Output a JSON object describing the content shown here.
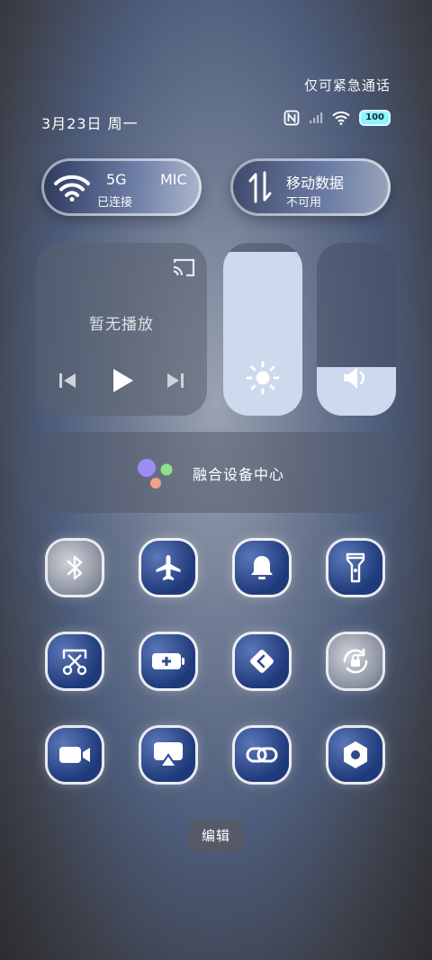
{
  "status_bar": {
    "emergency_text": "仅可紧急通话",
    "date_text": "3月23日 周一",
    "battery_level": "100"
  },
  "network": {
    "wifi": {
      "name": "5G",
      "name_suffix": "MIC",
      "status": "已连接"
    },
    "mobile_data": {
      "title": "移动数据",
      "status": "不可用"
    }
  },
  "media": {
    "empty_text": "暂无播放"
  },
  "sliders": {
    "brightness_level": 0.95,
    "volume_level": 0.28
  },
  "device_center": {
    "label": "融合设备中心"
  },
  "toggles": [
    {
      "name": "bluetooth",
      "icon": "bluetooth-icon"
    },
    {
      "name": "airplane-mode",
      "icon": "airplane-icon"
    },
    {
      "name": "ring-mode",
      "icon": "bell-icon"
    },
    {
      "name": "flashlight",
      "icon": "flashlight-icon"
    },
    {
      "name": "screenshot",
      "icon": "scissors-icon"
    },
    {
      "name": "battery-saver",
      "icon": "battery-plus-icon"
    },
    {
      "name": "app-hub",
      "icon": "diamond-link-icon"
    },
    {
      "name": "rotation-lock",
      "icon": "rotate-lock-icon"
    },
    {
      "name": "screen-recorder",
      "icon": "video-camera-icon"
    },
    {
      "name": "screen-cast",
      "icon": "cast-icon"
    },
    {
      "name": "link-share",
      "icon": "link-icon"
    },
    {
      "name": "settings",
      "icon": "hex-nut-icon"
    }
  ],
  "footer": {
    "edit_label": "编辑"
  },
  "colors": {
    "accent_tile": "#2d4a8c",
    "slider_fill": "#cdd9ec",
    "battery_fill": "#8ff3ff",
    "dot_purple": "#9c8cf5",
    "dot_green": "#8fe08a",
    "dot_orange": "#f2a08a"
  }
}
